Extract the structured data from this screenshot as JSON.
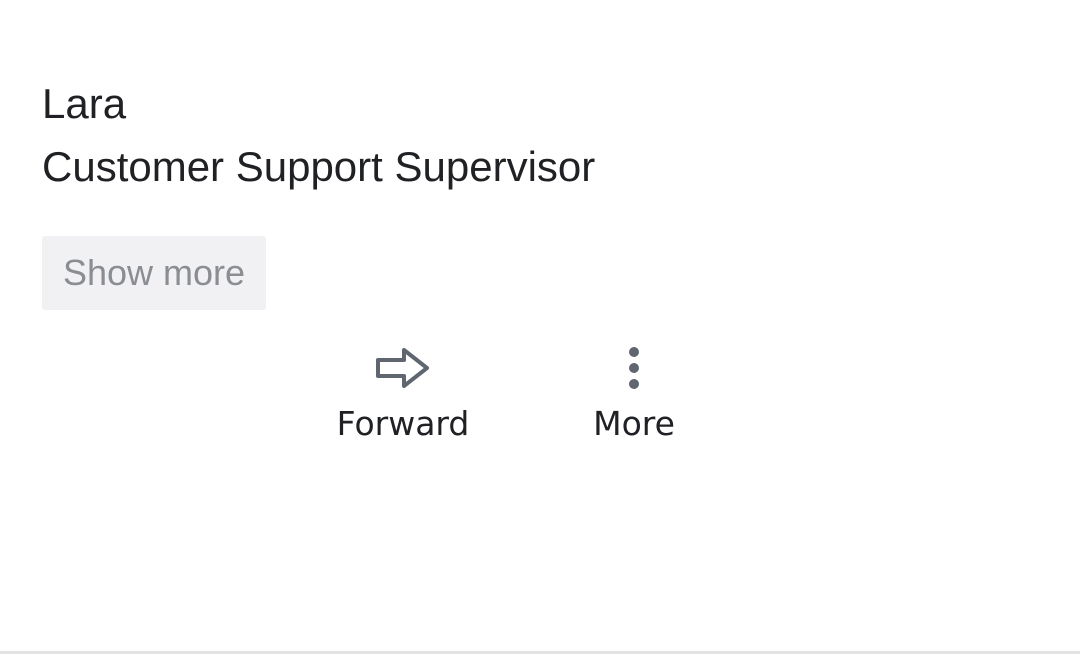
{
  "signature": {
    "name": "Lara",
    "title": "Customer Support Supervisor"
  },
  "show_more_label": "Show more",
  "actions": {
    "forward": {
      "label": "Forward",
      "icon": "forward-arrow-icon"
    },
    "more": {
      "label": "More",
      "icon": "more-vertical-icon"
    }
  },
  "colors": {
    "text": "#202124",
    "icon": "#5f6670",
    "button_bg": "#f1f1f4",
    "button_text": "#8a8d92"
  }
}
